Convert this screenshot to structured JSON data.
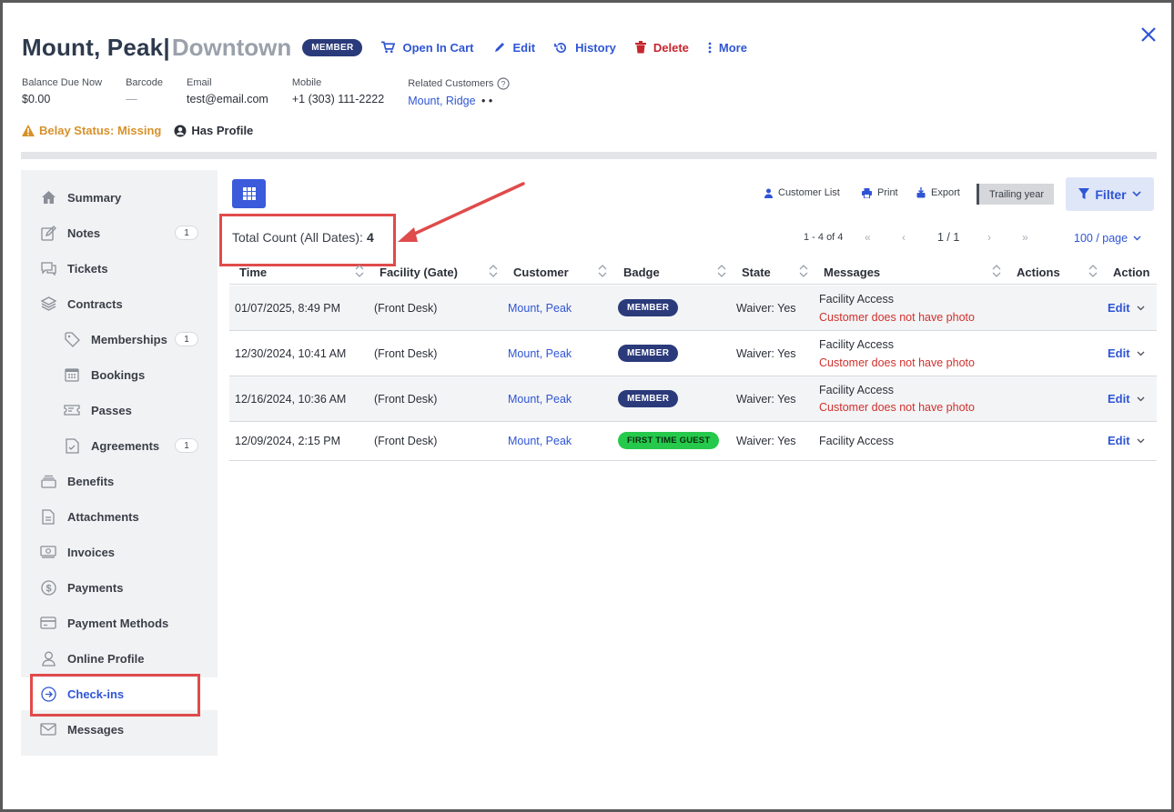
{
  "header": {
    "name": "Mount, Peak|",
    "location": "Downtown",
    "badge": "MEMBER",
    "actions": {
      "open_in_cart": "Open In Cart",
      "edit": "Edit",
      "history": "History",
      "delete": "Delete",
      "more": "More"
    }
  },
  "info": {
    "balance_label": "Balance Due Now",
    "balance_value": "$0.00",
    "barcode_label": "Barcode",
    "barcode_value": "—",
    "email_label": "Email",
    "email_value": "test@email.com",
    "mobile_label": "Mobile",
    "mobile_value": "+1 (303) 111-2222",
    "related_label": "Related Customers",
    "related_value": "Mount, Ridge",
    "related_dots": "•  •"
  },
  "status": {
    "belay": "Belay Status: Missing",
    "profile": "Has Profile"
  },
  "sidebar": {
    "items": [
      {
        "label": "Summary",
        "icon": "home-icon"
      },
      {
        "label": "Notes",
        "icon": "edit-note-icon",
        "count": "1"
      },
      {
        "label": "Tickets",
        "icon": "chat-icon"
      },
      {
        "label": "Contracts",
        "icon": "layers-icon"
      },
      {
        "label": "Memberships",
        "icon": "tag-icon",
        "count": "1"
      },
      {
        "label": "Bookings",
        "icon": "calendar-icon"
      },
      {
        "label": "Passes",
        "icon": "ticket-icon"
      },
      {
        "label": "Agreements",
        "icon": "document-check-icon",
        "count": "1"
      },
      {
        "label": "Benefits",
        "icon": "stack-icon"
      },
      {
        "label": "Attachments",
        "icon": "file-icon"
      },
      {
        "label": "Invoices",
        "icon": "money-icon"
      },
      {
        "label": "Payments",
        "icon": "dollar-circle-icon"
      },
      {
        "label": "Payment Methods",
        "icon": "credit-card-icon"
      },
      {
        "label": "Online Profile",
        "icon": "user-icon"
      },
      {
        "label": "Check-ins",
        "icon": "arrow-circle-icon"
      },
      {
        "label": "Messages",
        "icon": "mail-icon"
      }
    ]
  },
  "toolbar": {
    "customer_list": "Customer List",
    "print": "Print",
    "export": "Export",
    "trailing_year": "Trailing year",
    "filter": "Filter"
  },
  "summary": {
    "total_label": "Total Count (All Dates):",
    "total_value": "4"
  },
  "pagination": {
    "range": "1 - 4 of 4",
    "page": "1 / 1",
    "per_page": "100 / page",
    "first": "«",
    "prev": "‹",
    "next": "›",
    "last": "»"
  },
  "table": {
    "columns": [
      "Time",
      "Facility (Gate)",
      "Customer",
      "Badge",
      "State",
      "Messages",
      "Actions",
      "Action"
    ],
    "rows": [
      {
        "time": "01/07/2025, 8:49 PM",
        "facility": "(Front Desk)",
        "customer": "Mount, Peak",
        "badge": "MEMBER",
        "state": "Waiver: Yes",
        "message": "Facility Access",
        "warning": "Customer does not have photo",
        "action": "Edit"
      },
      {
        "time": "12/30/2024, 10:41 AM",
        "facility": "(Front Desk)",
        "customer": "Mount, Peak",
        "badge": "MEMBER",
        "state": "Waiver: Yes",
        "message": "Facility Access",
        "warning": "Customer does not have photo",
        "action": "Edit"
      },
      {
        "time": "12/16/2024, 10:36 AM",
        "facility": "(Front Desk)",
        "customer": "Mount, Peak",
        "badge": "MEMBER",
        "state": "Waiver: Yes",
        "message": "Facility Access",
        "warning": "Customer does not have photo",
        "action": "Edit"
      },
      {
        "time": "12/09/2024, 2:15 PM",
        "facility": "(Front Desk)",
        "customer": "Mount, Peak",
        "badge": "FIRST TIME GUEST",
        "state": "Waiver: Yes",
        "message": "Facility Access",
        "action": "Edit"
      }
    ]
  },
  "colors": {
    "accent": "#2f55d4",
    "member_badge": "#2a3a7a",
    "guest_badge": "#26c94b",
    "warning": "#d0312d",
    "belay": "#d7912a",
    "highlight": "#e04b4b"
  }
}
